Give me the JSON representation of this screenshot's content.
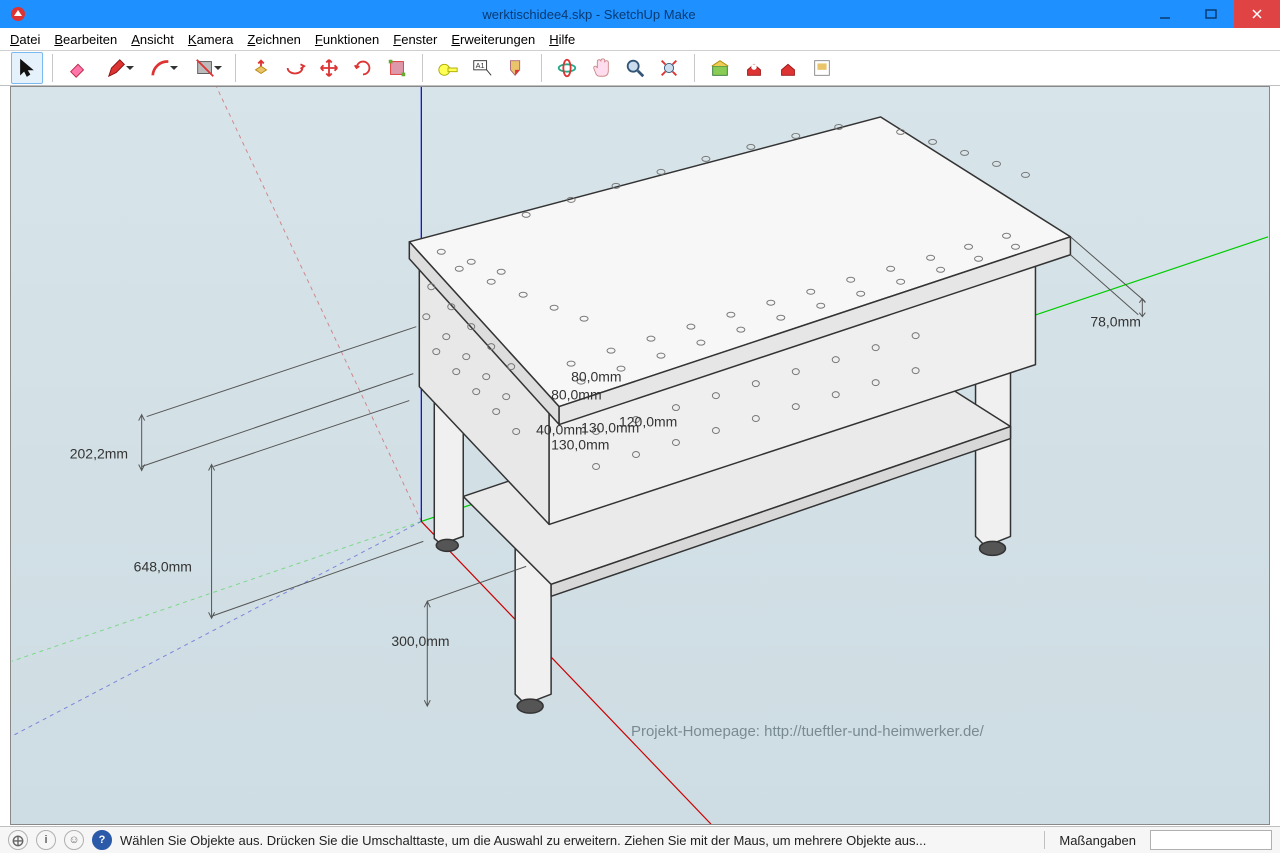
{
  "window": {
    "title": "werktischidee4.skp - SketchUp Make"
  },
  "menu": {
    "items": [
      {
        "u": "D",
        "rest": "atei"
      },
      {
        "u": "B",
        "rest": "earbeiten"
      },
      {
        "u": "A",
        "rest": "nsicht"
      },
      {
        "u": "K",
        "rest": "amera"
      },
      {
        "u": "Z",
        "rest": "eichnen"
      },
      {
        "u": "F",
        "rest": "unktionen"
      },
      {
        "u": "F",
        "rest": "enster"
      },
      {
        "u": "E",
        "rest": "rweiterungen"
      },
      {
        "u": "H",
        "rest": "ilfe"
      }
    ]
  },
  "status": {
    "hint": "Wählen Sie Objekte aus. Drücken Sie die Umschalttaste, um die Auswahl zu erweitern. Ziehen Sie mit der Maus, um mehrere Objekte aus...",
    "mass_label": "Maßangaben",
    "mass_value": ""
  },
  "dimensions": {
    "d1": "202,2mm",
    "d2": "648,0mm",
    "d3": "300,0mm",
    "d4": "78,0mm",
    "d5": "80,0mm",
    "d6": "80,0mm",
    "d7": "40,0mm",
    "d8": "130,0mm",
    "d9": "120,0mm",
    "d10": "130,0mm"
  },
  "watermark": "Projekt-Homepage: http://tueftler-und-heimwerker.de/",
  "icons": {
    "select": "select-icon",
    "eraser": "eraser-icon",
    "pencil": "pencil-icon",
    "arc": "arc-icon",
    "rect": "rect-icon",
    "pushpull": "pushpull-icon",
    "offset": "offset-icon",
    "move": "move-icon",
    "rotate": "rotate-icon",
    "scale": "scale-icon",
    "tape": "tape-icon",
    "text": "text-icon",
    "paint": "paint-icon",
    "orbit": "orbit-icon",
    "pan": "pan-icon",
    "zoom": "zoom-icon",
    "zoomext": "zoomext-icon",
    "warehouse": "warehouse-icon",
    "extwh": "extwh-icon",
    "share": "share-icon",
    "layout": "layout-icon"
  }
}
